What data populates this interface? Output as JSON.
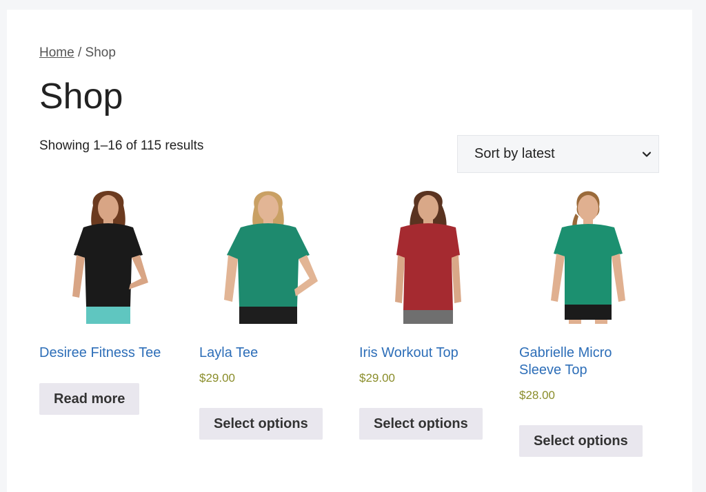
{
  "breadcrumb": {
    "home": "Home",
    "separator": " / ",
    "current": "Shop"
  },
  "page_title": "Shop",
  "result_count": "Showing 1–16 of 115 results",
  "sort": {
    "selected": "Sort by latest"
  },
  "products": [
    {
      "name": "Desiree Fitness Tee",
      "price": "",
      "button": "Read more",
      "shirt_color": "#1a1a1a",
      "pants_color": "#5fc6c0",
      "hair_color": "#6b3a1f"
    },
    {
      "name": "Layla Tee",
      "price": "$29.00",
      "button": "Select options",
      "shirt_color": "#1e8a6e",
      "pants_color": "#1e1e1e",
      "hair_color": "#c9a064"
    },
    {
      "name": "Iris Workout Top",
      "price": "$29.00",
      "button": "Select options",
      "shirt_color": "#a52a30",
      "pants_color": "#6f6f6f",
      "hair_color": "#5a3320"
    },
    {
      "name": "Gabrielle Micro Sleeve Top",
      "price": "$28.00",
      "button": "Select options",
      "shirt_color": "#1c9070",
      "pants_color": "#1b1b1b",
      "hair_color": "#9a6a3a"
    }
  ],
  "colors": {
    "link": "#2d6eb8",
    "price": "#8a8d2a",
    "button_bg": "#e9e7ee"
  }
}
